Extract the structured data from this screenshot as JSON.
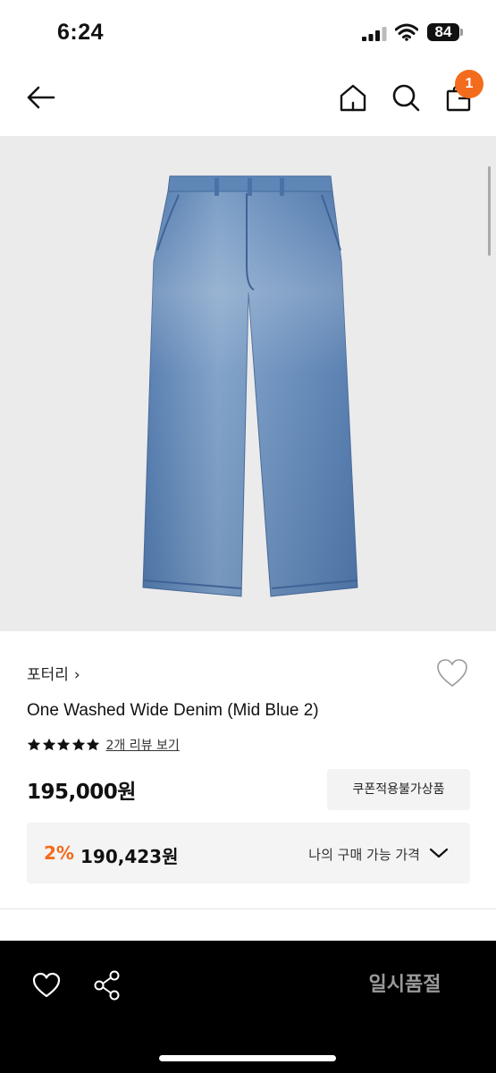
{
  "status": {
    "time": "6:24",
    "battery": "84"
  },
  "nav": {
    "cart_count": "1",
    "icons": [
      "back-arrow-icon",
      "home-icon",
      "search-icon",
      "shopping-bag-icon"
    ]
  },
  "product": {
    "brand": "포터리",
    "brand_chevron": "›",
    "name": "One Washed Wide Denim (Mid Blue 2)",
    "rating_stars": 5,
    "review_link": "2개 리뷰 보기",
    "price": "195,000원",
    "coupon_label": "쿠폰적용불가상품",
    "discount": {
      "percent": "2%",
      "price": "190,423원",
      "label": "나의 구매 가능 가격"
    }
  },
  "colors": {
    "accent": "#f36b1c",
    "bottom_bar": "#000000",
    "image_bg": "#ebebeb",
    "denim": "#5d86b6"
  },
  "bottom_bar": {
    "soldout_label": "일시품절",
    "icons": [
      "heart-icon",
      "share-icon"
    ]
  }
}
